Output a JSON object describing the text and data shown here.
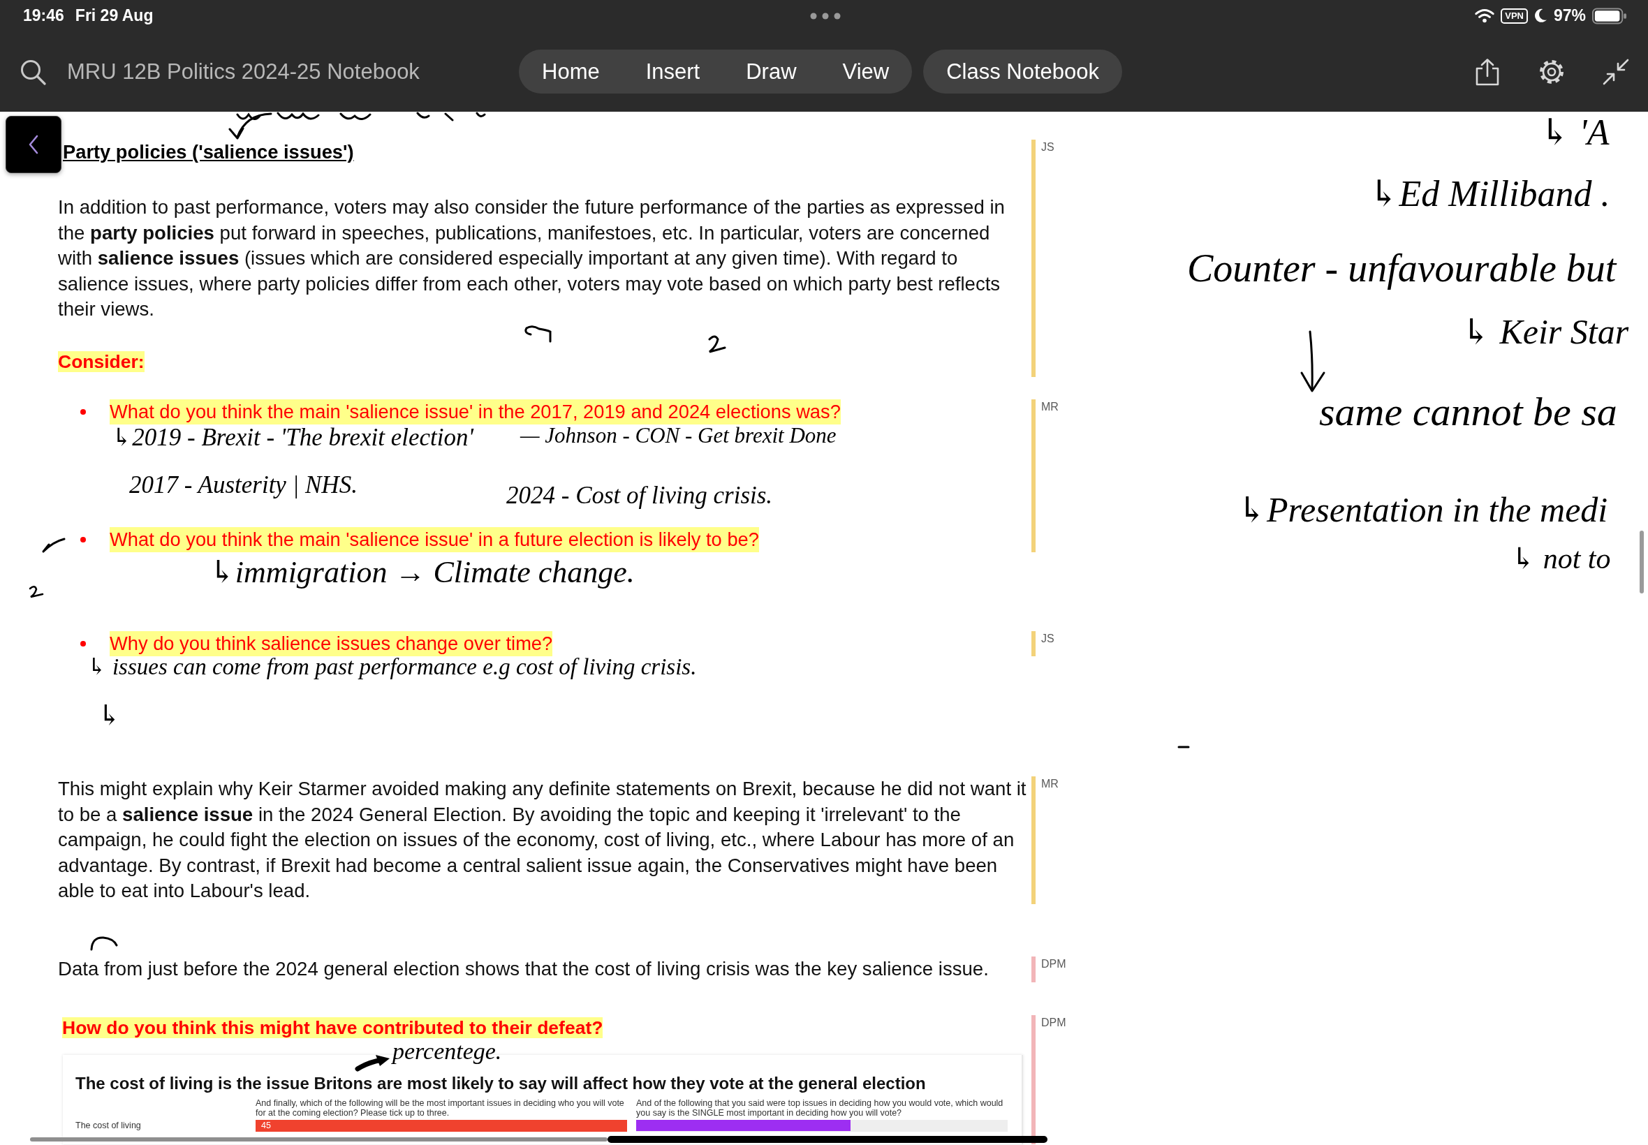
{
  "status_bar": {
    "time": "19:46",
    "date": "Fri 29 Aug",
    "vpn_badge": "VPN",
    "battery": "97%"
  },
  "toolbar": {
    "notebook_title": "MRU 12B Politics 2024-25 Notebook",
    "tabs": [
      {
        "label": "Home",
        "selected": false
      },
      {
        "label": "Insert",
        "selected": false
      },
      {
        "label": "Draw",
        "selected": false
      },
      {
        "label": "View",
        "selected": false
      }
    ],
    "class_notebook_button": "Class Notebook"
  },
  "page": {
    "sections": [
      {
        "author": "JS",
        "color": "#f3d27a",
        "heading": "Party policies ('salience issues')",
        "items": [
          {
            "kind": "paragraph",
            "text": "In addition to past performance, voters may also consider the future performance of the parties as expressed in the **party policies** put forward in speeches, publications, manifestoes, etc. In particular, voters are concerned with **salience issues** (issues which are considered especially important at any given time). With regard to salience issues, where party policies differ from each other, voters may vote based on which party best reflects their views."
          }
        ],
        "label": "Consider:"
      },
      {
        "author": "MR",
        "color": "#f3d27a",
        "items": [
          {
            "kind": "bullet",
            "text": "What do you think the main 'salience issue' in the 2017, 2019 and 2024 elections was?"
          },
          {
            "kind": "bullet",
            "text": "What do you think the main 'salience issue' in a future election is likely to be?"
          }
        ]
      },
      {
        "author": "JS",
        "color": "#f3d27a",
        "items": [
          {
            "kind": "bullet",
            "text": "Why do you think salience issues change over time?"
          }
        ]
      },
      {
        "author": "MR",
        "color": "#f3d27a",
        "items": [
          {
            "kind": "paragraph",
            "text": "This might explain why Keir Starmer avoided making any definite statements on Brexit, because he did not want it to be a **salience issue** in the 2024 General Election. By avoiding the topic and keeping it 'irrelevant' to the campaign, he could fight the election on issues of the economy, cost of living, etc., where Labour has more of an advantage. By contrast, if Brexit had become a central salient issue again, the Conservatives might have been able to eat into Labour's lead."
          }
        ]
      },
      {
        "author": "DPM",
        "color": "#f2b5b8",
        "items": [
          {
            "kind": "paragraph",
            "text": "Data from just before the 2024 general election shows that the cost of living crisis was the key salience issue."
          }
        ]
      },
      {
        "author": "DPM",
        "color": "#f2b5b8",
        "items": [
          {
            "kind": "question",
            "text": "How do you think this might have contributed to their defeat?"
          },
          {
            "kind": "chart",
            "title": "The cost of living is the issue Britons are most likely to say will affect how they vote at the general election",
            "questions": [
              "And finally, which of the following will be the most important issues in deciding who you will vote for at the coming election? Please tick up to three.",
              "And of the following that you said were top issues in deciding how you would vote, which would you say is the SINGLE most important in deciding how you will vote?"
            ],
            "rows": [
              {
                "label": "The cost of living",
                "value_label": "45"
              }
            ]
          }
        ]
      }
    ]
  },
  "ink_notes": [
    {
      "text": "↳2019 - Brexit - 'The brexit election'"
    },
    {
      "text": "— Johnson - CON - Get brexit Done"
    },
    {
      "text": "2017 - Austerity | NHS."
    },
    {
      "text": "2024 - Cost of living crisis."
    },
    {
      "text": "↳immigration → Climate change."
    },
    {
      "text": "↳ issues can come from past performance e.g cost of living crisis."
    },
    {
      "text": "↳"
    },
    {
      "text": "percentege."
    },
    {
      "text": "↳ 'A"
    },
    {
      "text": "↳Ed Milliband ."
    },
    {
      "text": "Counter - unfavourable but"
    },
    {
      "text": "↳ Keir Star"
    },
    {
      "text": "same cannot be sa"
    },
    {
      "text": "↳Presentation in the medi"
    },
    {
      "text": "↳ not to"
    }
  ]
}
